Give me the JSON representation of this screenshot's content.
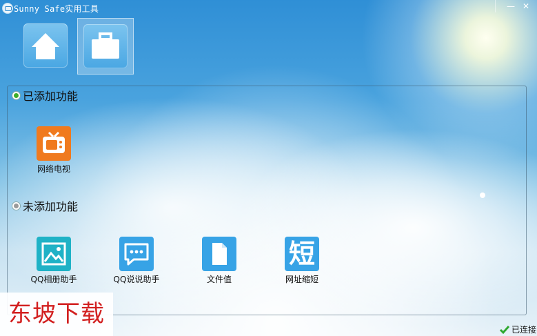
{
  "window": {
    "title": "Sunny Safe实用工具",
    "minimize_glyph": "—",
    "close_glyph": "✕"
  },
  "tabs": [
    {
      "icon": "home-icon",
      "selected": false
    },
    {
      "icon": "toolbox-icon",
      "selected": true
    }
  ],
  "sections": {
    "added": {
      "label": "已添加功能",
      "items": [
        {
          "label": "网络电视",
          "icon": "tv-icon",
          "color": "#f07a1e"
        }
      ]
    },
    "not_added": {
      "label": "未添加功能",
      "items": [
        {
          "label": "QQ相册助手",
          "icon": "photo-album-icon",
          "color": "#1fb2c6"
        },
        {
          "label": "QQ说说助手",
          "icon": "chat-bubble-icon",
          "color": "#37a3e6"
        },
        {
          "label": "文件值",
          "icon": "file-icon",
          "color": "#37a3e6"
        },
        {
          "label": "网址缩短",
          "icon": "short-char-icon",
          "glyph": "短",
          "color": "#37a3e6"
        }
      ]
    }
  },
  "watermark": "东坡下载",
  "status": {
    "text": "已连接",
    "icon": "check-icon",
    "color": "#2fa82f"
  }
}
